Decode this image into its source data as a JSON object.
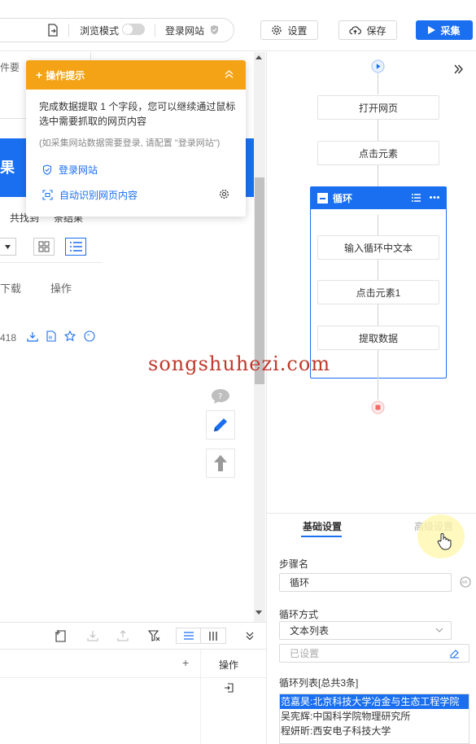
{
  "toolbar": {
    "browse_mode_label": "浏览模式",
    "login_site_label": "登录网站",
    "settings_label": "设置",
    "save_label": "保存",
    "collect_label": "采集"
  },
  "webpage": {
    "fragment_top": "件要",
    "fragment_result": "果",
    "fragment_found": "共找到",
    "fragment_result_count": "条结果",
    "col_download": "下载",
    "col_action": "操作",
    "row_fragment": "418"
  },
  "hint_panel": {
    "title": "操作提示",
    "message": "完成数据提取 1 个字段，您可以继续通过鼠标选中需要抓取的网页内容",
    "note": "(如采集网站数据需要登录, 请配置 \"登录网站\")",
    "link_login": "登录网站",
    "link_autodetect": "自动识别网页内容"
  },
  "data_table": {
    "header_action": "操作",
    "add_symbol": "+"
  },
  "workflow": {
    "nodes": [
      "打开网页",
      "点击元素"
    ],
    "loop": {
      "title": "循环",
      "children": [
        "输入循环中文本",
        "点击元素1",
        "提取数据"
      ]
    }
  },
  "watermark": "songshuhezi.com",
  "properties": {
    "tabs": [
      "基础设置",
      "高级设置"
    ],
    "step_name_label": "步骤名",
    "step_name_value": "循环",
    "loop_mode_label": "循环方式",
    "loop_mode_value": "文本列表",
    "configured_placeholder": "已设置",
    "loop_list_label": "循环列表[总共3条]",
    "loop_list_items": [
      "范嘉昊:北京科技大学冶金与生态工程学院",
      "吴宪辉:中国科学院物理研究所",
      "程妍昕:西安电子科技大学"
    ]
  },
  "colors": {
    "primary": "#1a6ff0",
    "hint_orange": "#f5a316",
    "watermark": "#c0392b"
  }
}
